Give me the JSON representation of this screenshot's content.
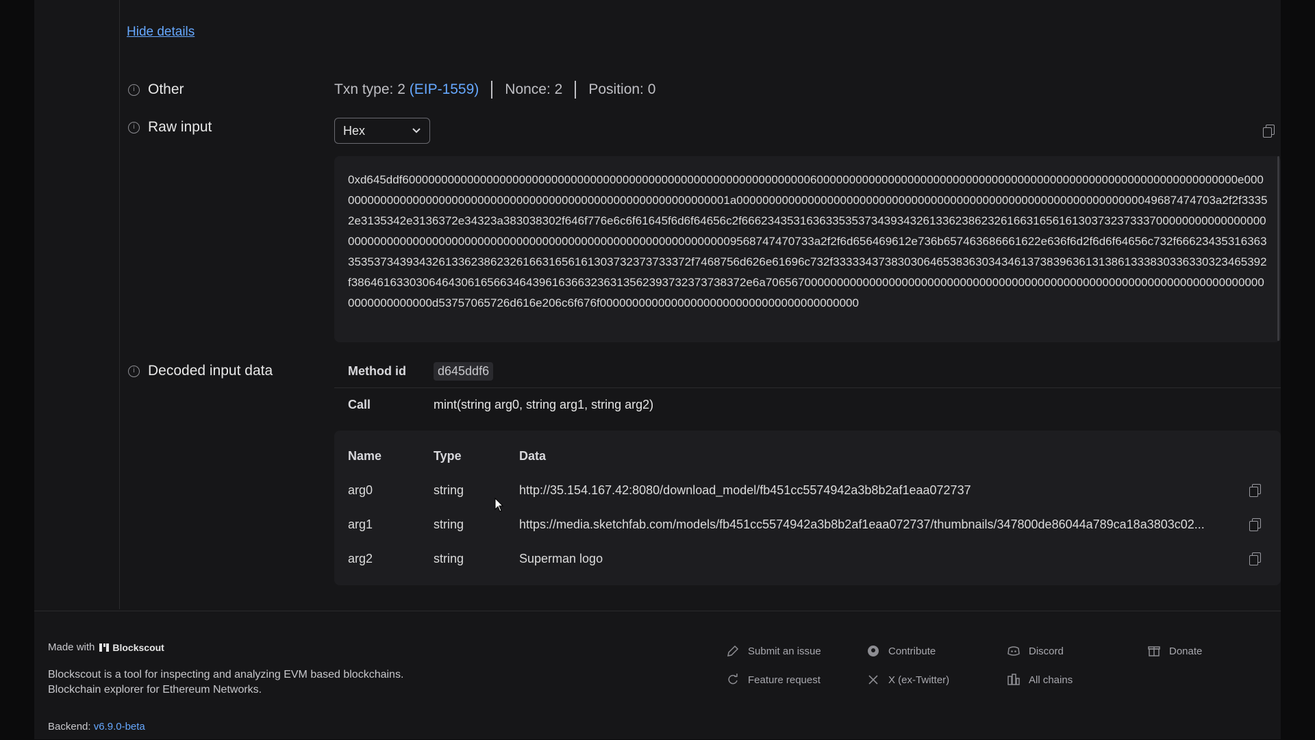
{
  "details": {
    "hide_link": "Hide details"
  },
  "other": {
    "label": "Other",
    "txn_type_label": "Txn type: 2",
    "txn_type_detail": "(EIP-1559)",
    "nonce": "Nonce: 2",
    "position": "Position: 0"
  },
  "raw_input": {
    "label": "Raw input",
    "format_selected": "Hex",
    "value": "0xd645ddf600000000000000000000000000000000000000000000000000000000000000600000000000000000000000000000000000000000000000000000000000000000e00000000000000000000000000000000000000000000000000000000000001a00000000000000000000000000000000000000000000000000000000000000049687474703a2f2f33352e3135342e3136372e34323a383038302f646f776e6c6f61645f6d6f64656c2f666234353163633535373439343261336238623261663165616130373237333700000000000000000000000000000000000000000000000000000000000000000000000000009568747470733a2f2f6d656469612e736b657463686661622e636f6d2f6d6f64656c732f6662343531636335353734393432613362386232616631656161303732373733372f7468756d626e61696c732f3333343738303064653836303434613738396361313861333830336330323465392f3864616330306464306165663464396163663236313562393732373738372e6a706567000000000000000000000000000000000000000000000000000000000000000000000000000000000000d53757065726d616e206c6f676f0000000000000000000000000000000000000000"
  },
  "decoded": {
    "label": "Decoded input data",
    "method_id_label": "Method id",
    "method_id": "d645ddf6",
    "call_label": "Call",
    "call": "mint(string arg0, string arg1, string arg2)",
    "table": {
      "headers": {
        "name": "Name",
        "type": "Type",
        "data": "Data"
      },
      "rows": [
        {
          "name": "arg0",
          "type": "string",
          "data": "http://35.154.167.42:8080/download_model/fb451cc5574942a3b8b2af1eaa072737"
        },
        {
          "name": "arg1",
          "type": "string",
          "data": "https://media.sketchfab.com/models/fb451cc5574942a3b8b2af1eaa072737/thumbnails/347800de86044a789ca18a3803c02..."
        },
        {
          "name": "arg2",
          "type": "string",
          "data": "Superman logo"
        }
      ]
    }
  },
  "footer": {
    "made_with": "Made with",
    "brand": "Blockscout",
    "desc_line1": "Blockscout is a tool for inspecting and analyzing EVM based blockchains.",
    "desc_line2": "Blockchain explorer for Ethereum Networks.",
    "backend_label": "Backend:",
    "backend_version": "v6.9.0-beta",
    "links": {
      "submit_issue": "Submit an issue",
      "contribute": "Contribute",
      "discord": "Discord",
      "donate": "Donate",
      "feature_request": "Feature request",
      "x_twitter": "X (ex-Twitter)",
      "all_chains": "All chains"
    }
  },
  "colors": {
    "accent": "#66a8ff",
    "panel": "#1d1d20",
    "background": "#161618"
  }
}
